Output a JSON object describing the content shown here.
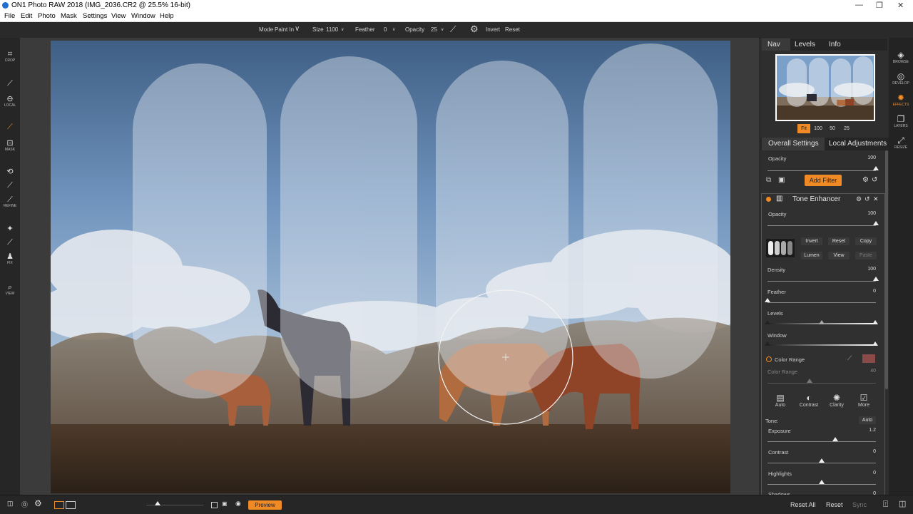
{
  "window": {
    "title": "ON1 Photo RAW 2018 (IMG_2036.CR2 @ 25.5% 16-bit)",
    "controls": [
      "—",
      "❐",
      "✕"
    ]
  },
  "menu": [
    "File",
    "Edit",
    "Photo",
    "Mask",
    "Settings",
    "View",
    "Window",
    "Help"
  ],
  "options": {
    "mode_label": "Mode",
    "mode_value": "Paint In",
    "size_label": "Size",
    "size_value": "1100",
    "feather_label": "Feather",
    "feather_value": "0",
    "opacity_label": "Opacity",
    "opacity_value": "25",
    "invert": "Invert",
    "reset": "Reset"
  },
  "left_tools": [
    {
      "icon": "crop-icon",
      "glyph": "⌗",
      "label": "CROP"
    },
    {
      "icon": "brush-icon",
      "glyph": "⟋",
      "label": ""
    },
    {
      "icon": "local-icon",
      "glyph": "⊖",
      "label": "LOCAL"
    },
    {
      "icon": "mask-brush-icon",
      "glyph": "⟋",
      "label": ""
    },
    {
      "icon": "mask-icon",
      "glyph": "⊡",
      "label": "MASK"
    },
    {
      "icon": "refine-brush-icon",
      "glyph": "⟲",
      "label": ""
    },
    {
      "icon": "refine-tool-icon",
      "glyph": "⟋",
      "label": ""
    },
    {
      "icon": "refine-icon",
      "glyph": "⟋",
      "label": "REFINE"
    },
    {
      "icon": "retouch-icon",
      "glyph": "✦",
      "label": ""
    },
    {
      "icon": "clone-icon",
      "glyph": "⟋",
      "label": ""
    },
    {
      "icon": "fix-icon",
      "glyph": "♟",
      "label": "FIX"
    },
    {
      "icon": "view-icon",
      "glyph": "⌕",
      "label": "VIEW"
    }
  ],
  "right_tools": [
    {
      "icon": "browse-icon",
      "glyph": "◈",
      "label": "BROWSE"
    },
    {
      "icon": "develop-icon",
      "glyph": "◎",
      "label": "DEVELOP"
    },
    {
      "icon": "effects-icon",
      "glyph": "✹",
      "label": "EFFECTS"
    },
    {
      "icon": "layers-icon",
      "glyph": "❐",
      "label": "LAYERS"
    },
    {
      "icon": "resize-icon",
      "glyph": "⤢",
      "label": "RESIZE"
    }
  ],
  "nav": {
    "tabs": [
      "Nav",
      "Levels",
      "Info"
    ],
    "zoom": [
      "Fit",
      "100",
      "50",
      "25"
    ]
  },
  "settings_tabs": [
    "Overall Settings",
    "Local Adjustments"
  ],
  "overall": {
    "opacity_label": "Opacity",
    "opacity_value": "100",
    "add_filter": "Add Filter",
    "opacity_level": 1.0
  },
  "filter": {
    "name": "Tone Enhancer",
    "opacity_label": "Opacity",
    "opacity_value": "100",
    "opacity_level": 1.0,
    "buttons_row1": [
      "Invert",
      "Reset",
      "Copy"
    ],
    "buttons_row2": [
      "Lumen",
      "View",
      "Paste"
    ],
    "density_label": "Density",
    "density_value": "100",
    "density_level": 1.0,
    "feather_label": "Feather",
    "feather_value": "0",
    "feather_level": 0,
    "levels_label": "Levels",
    "window_label": "Window",
    "color_range_label": "Color Range",
    "color_range_swatch": "#8a4a48",
    "color_range_sub_label": "Color Range",
    "color_range_value": "40",
    "presets": [
      "Auto",
      "Contrast",
      "Clarity",
      "More"
    ],
    "tone_label": "Tone:",
    "tone_auto": "Auto",
    "exposure_label": "Exposure",
    "exposure_value": "1.2",
    "contrast_label": "Contrast",
    "contrast_value": "0",
    "highlights_label": "Highlights",
    "highlights_value": "0",
    "shadows_label": "Shadows",
    "shadows_value": "0"
  },
  "bottom": {
    "preview": "Preview",
    "reset_all": "Reset All",
    "reset": "Reset",
    "sync": "Sync"
  },
  "colors": {
    "accent": "#f08a24",
    "panel": "#2e2e2e",
    "canvas": "#3b3b3b"
  }
}
